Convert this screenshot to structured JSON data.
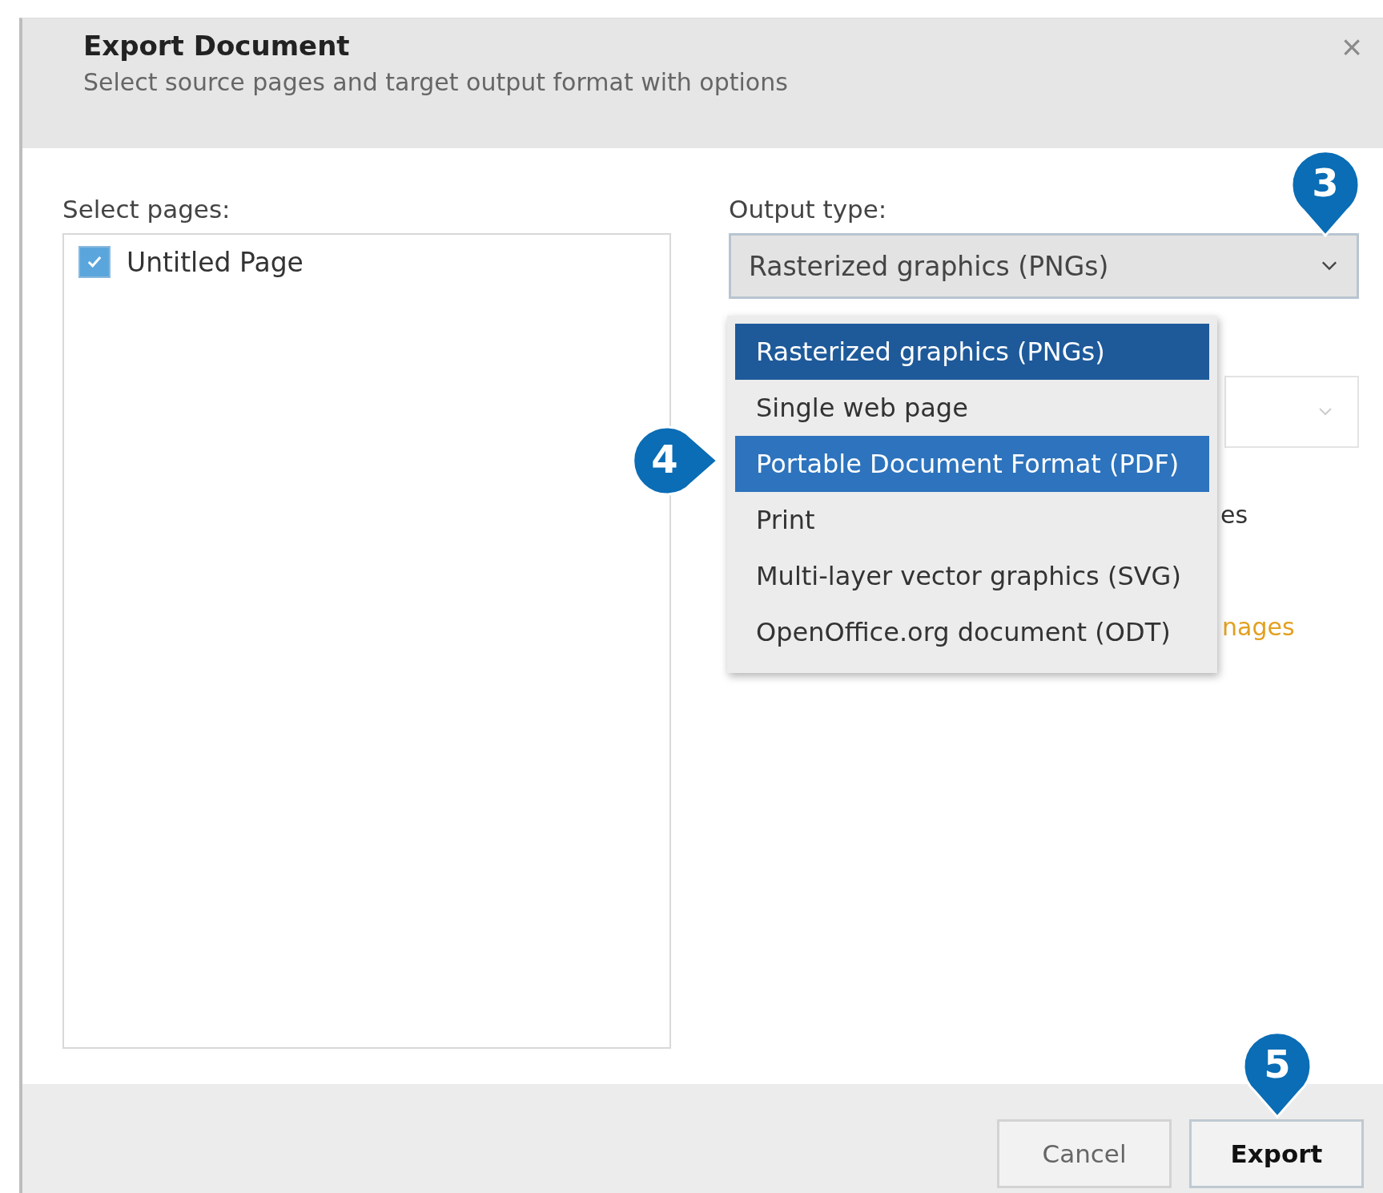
{
  "dialog": {
    "title": "Export Document",
    "subtitle": "Select source pages and target output format with options",
    "close": "×"
  },
  "pages": {
    "label": "Select pages:",
    "items": [
      {
        "label": "Untitled Page",
        "checked": true
      }
    ]
  },
  "output": {
    "label": "Output type:",
    "value": "Rasterized graphics (PNGs)",
    "expanded": true,
    "options": [
      {
        "label": "Rasterized graphics (PNGs)",
        "selected": true,
        "hovered": false
      },
      {
        "label": "Single web page",
        "selected": false,
        "hovered": false
      },
      {
        "label": "Portable Document Format (PDF)",
        "selected": false,
        "hovered": true
      },
      {
        "label": "Print",
        "selected": false,
        "hovered": false
      },
      {
        "label": "Multi-layer vector graphics (SVG)",
        "selected": false,
        "hovered": false
      },
      {
        "label": "OpenOffice.org document (ODT)",
        "selected": false,
        "hovered": false
      }
    ]
  },
  "hidden_texts": [
    {
      "text": "es",
      "kind": "plain"
    },
    {
      "text": "nages",
      "kind": "link"
    }
  ],
  "callouts": [
    {
      "number": "3",
      "kind": "down"
    },
    {
      "number": "4",
      "kind": "right"
    },
    {
      "number": "5",
      "kind": "down"
    }
  ],
  "buttons": [
    {
      "label": "Cancel",
      "primary": false
    },
    {
      "label": "Export",
      "primary": true
    }
  ]
}
